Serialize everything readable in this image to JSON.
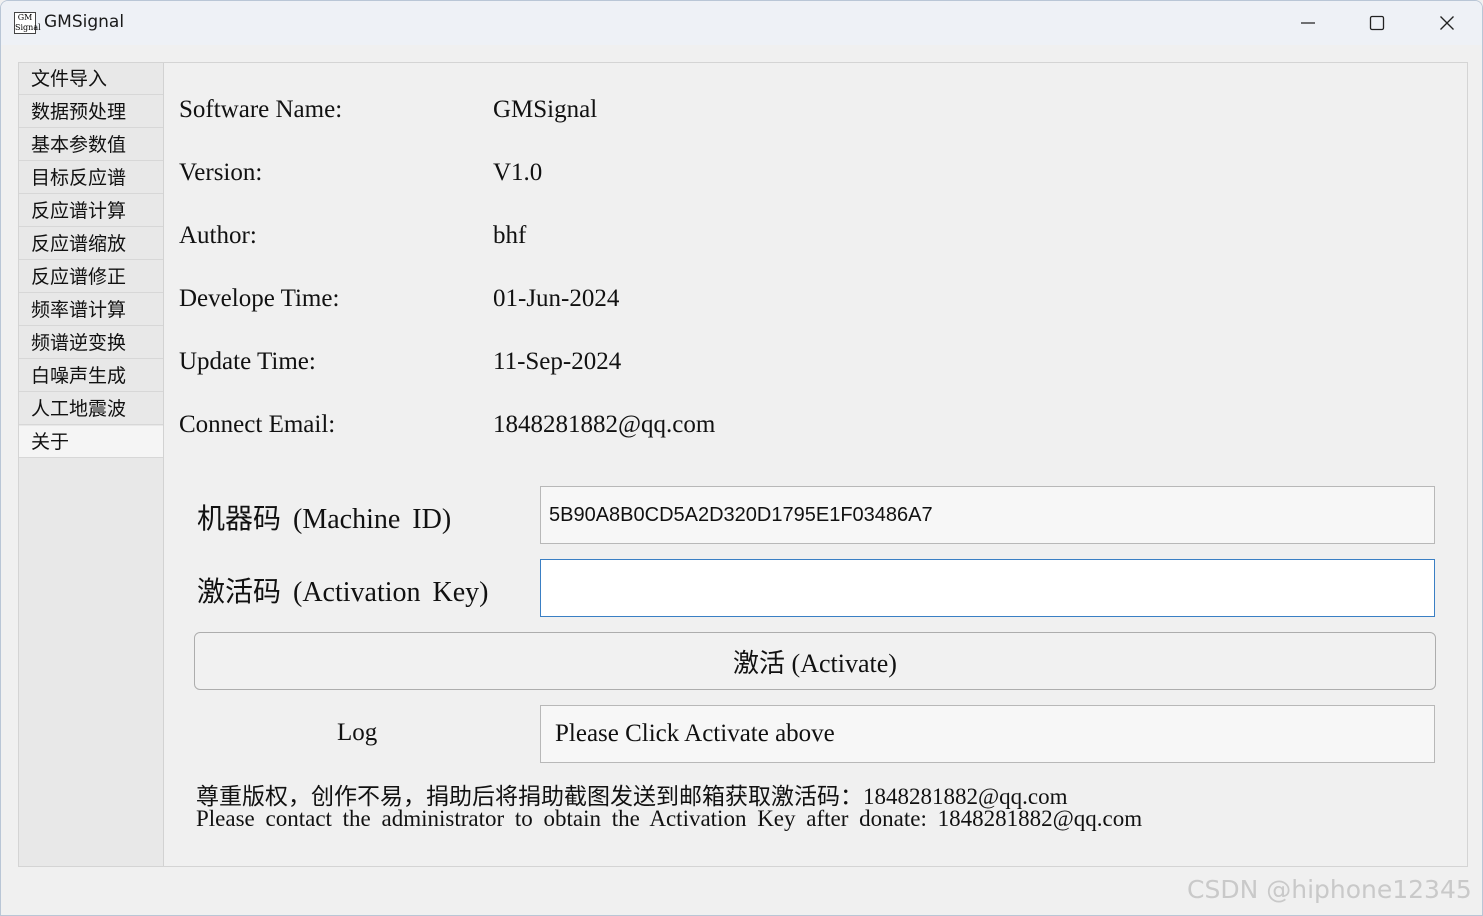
{
  "window": {
    "title": "GMSignal",
    "icon_text": "GM Signal"
  },
  "sidebar": {
    "items": [
      {
        "label": "文件导入"
      },
      {
        "label": "数据预处理"
      },
      {
        "label": "基本参数值"
      },
      {
        "label": "目标反应谱"
      },
      {
        "label": "反应谱计算"
      },
      {
        "label": "反应谱缩放"
      },
      {
        "label": "反应谱修正"
      },
      {
        "label": "频率谱计算"
      },
      {
        "label": "频谱逆变换"
      },
      {
        "label": "白噪声生成"
      },
      {
        "label": "人工地震波"
      },
      {
        "label": "关于"
      }
    ],
    "active_index": 11
  },
  "about": {
    "software_name_label": "Software Name:",
    "software_name_value": "GMSignal",
    "version_label": "Version:",
    "version_value": "V1.0",
    "author_label": "Author:",
    "author_value": "bhf",
    "develop_time_label": "Develope Time:",
    "develop_time_value": "01-Jun-2024",
    "update_time_label": "Update Time:",
    "update_time_value": "11-Sep-2024",
    "email_label": "Connect Email:",
    "email_value": "1848281882@qq.com"
  },
  "activation": {
    "machine_id_label": "机器码 (Machine ID)",
    "machine_id_value": "5B90A8B0CD5A2D320D1795E1F03486A7",
    "activation_key_label": "激活码 (Activation Key)",
    "activation_key_value": "",
    "activate_button_label": "激活 (Activate)",
    "log_label": "Log",
    "log_value": "Please Click Activate above",
    "note_cn": "尊重版权，创作不易，捐助后将捐助截图发送到邮箱获取激活码：1848281882@qq.com",
    "note_en": "Please contact the administrator to obtain the Activation Key after donate: 1848281882@qq.com"
  },
  "watermark": "CSDN @hiphone12345",
  "colors": {
    "titlebar_bg": "#eef1f6",
    "window_bg": "#f0f0f0",
    "sidebar_bg": "#e8e8e8",
    "focus_border": "#3a7fc4"
  }
}
